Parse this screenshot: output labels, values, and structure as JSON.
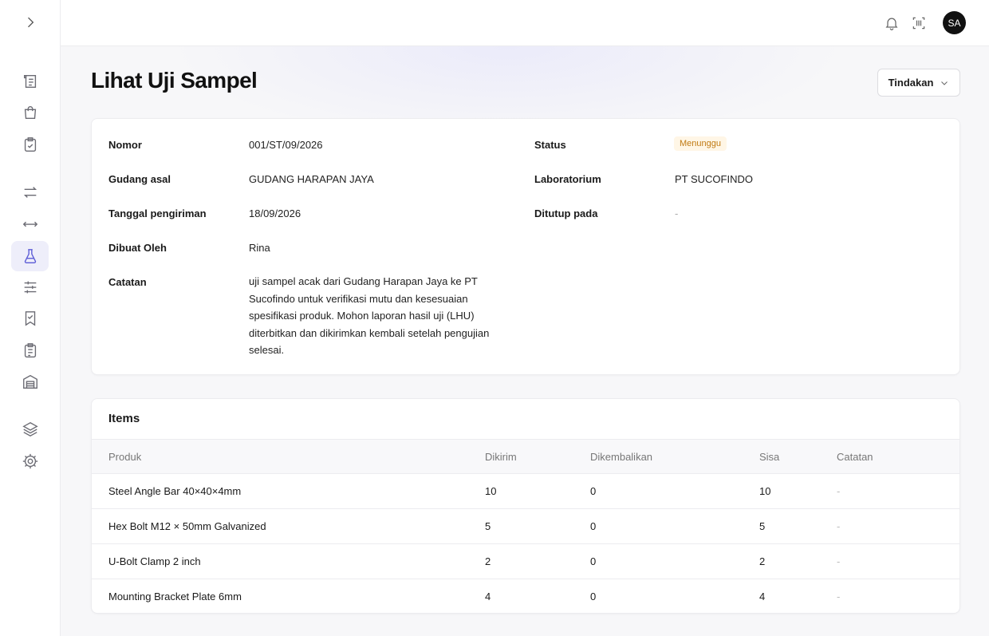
{
  "page": {
    "title": "Lihat Uji Sampel",
    "action_label": "Tindakan"
  },
  "user": {
    "initials": "SA"
  },
  "sidebar": {
    "icons": [
      "ledger-icon",
      "shopping-bag-icon",
      "clipboard-check-icon",
      "transfer-icon",
      "move-icon",
      "flask-icon",
      "sliders-icon",
      "bookmark-check-icon",
      "clipboard-list-icon",
      "warehouse-icon",
      "layers-icon",
      "gear-icon"
    ],
    "active": "flask-icon"
  },
  "details": {
    "nomor_label": "Nomor",
    "nomor": "001/ST/09/2026",
    "gudang_label": "Gudang asal",
    "gudang": "GUDANG HARAPAN JAYA",
    "tanggal_label": "Tanggal pengiriman",
    "tanggal": "18/09/2026",
    "dibuat_label": "Dibuat Oleh",
    "dibuat": "Rina",
    "catatan_label": "Catatan",
    "catatan_lines": [
      "uji sampel acak dari Gudang Harapan Jaya ke PT",
      "Sucofindo untuk verifikasi mutu dan kesesuaian",
      "spesifikasi produk. Mohon laporan hasil uji (LHU)",
      "diterbitkan dan dikirimkan kembali setelah pengujian",
      "selesai."
    ],
    "status_label": "Status",
    "status": "Menunggu",
    "lab_label": "Laboratorium",
    "lab": "PT SUCOFINDO",
    "ditutup_label": "Ditutup pada",
    "ditutup": "-",
    "status_color": "#c07a12"
  },
  "items": {
    "title": "Items",
    "columns": [
      "Produk",
      "Dikirim",
      "Dikembalikan",
      "Sisa",
      "Catatan"
    ],
    "rows": [
      [
        "Steel Angle Bar 40×40×4mm",
        "10",
        "0",
        "10",
        "-"
      ],
      [
        "Hex Bolt M12 × 50mm Galvanized",
        "5",
        "0",
        "5",
        "-"
      ],
      [
        "U-Bolt Clamp 2 inch",
        "2",
        "0",
        "2",
        "-"
      ],
      [
        "Mounting Bracket Plate 6mm",
        "4",
        "0",
        "4",
        "-"
      ]
    ]
  }
}
